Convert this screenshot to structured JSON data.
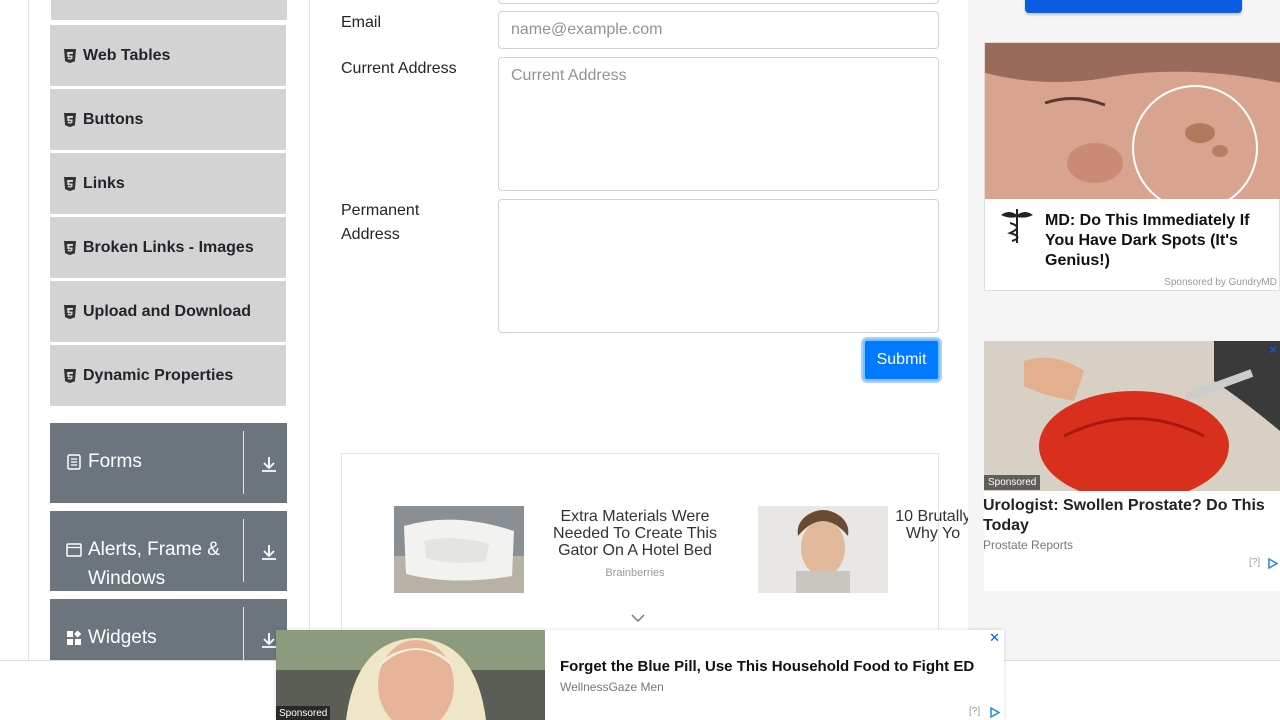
{
  "sidebar": {
    "items": [
      {
        "label": "Web Tables"
      },
      {
        "label": "Buttons"
      },
      {
        "label": "Links"
      },
      {
        "label": "Broken Links - Images"
      },
      {
        "label": "Upload and Download"
      },
      {
        "label": "Dynamic Properties"
      }
    ],
    "groups": [
      {
        "label": "Forms"
      },
      {
        "label": "Alerts, Frame &",
        "label2": "Windows"
      },
      {
        "label": "Widgets"
      }
    ]
  },
  "form": {
    "email_label": "Email",
    "email_placeholder": "name@example.com",
    "current_label": "Current Address",
    "current_placeholder": "Current Address",
    "permanent_label_1": "Permanent",
    "permanent_label_2": "Address",
    "submit": "Submit"
  },
  "content_ads": [
    {
      "title": "Extra Materials Were Needed To Create This Gator On A Hotel Bed",
      "source": "Brainberries"
    },
    {
      "title": "10 Brutally Why Yo",
      "source": ""
    }
  ],
  "right_ads": {
    "ad1_title": "MD: Do This Immediately If You Have Dark Spots (It's Genius!)",
    "ad1_sponsor": "Sponsored by GundryMD",
    "ad2_badge": "Sponsored",
    "ad2_title": "Urologist: Swollen Prostate? Do This Today",
    "ad2_source": "Prostate Reports",
    "ad2_help": "[?]"
  },
  "bottom_ad": {
    "title": "Forget the Blue Pill, Use This Household Food to Fight ED",
    "source": "WellnessGaze Men",
    "badge": "Sponsored",
    "help": "[?]"
  },
  "colors": {
    "primary": "#007bff",
    "menu_bg": "#d3d3d3",
    "group_bg": "#6c757d"
  }
}
